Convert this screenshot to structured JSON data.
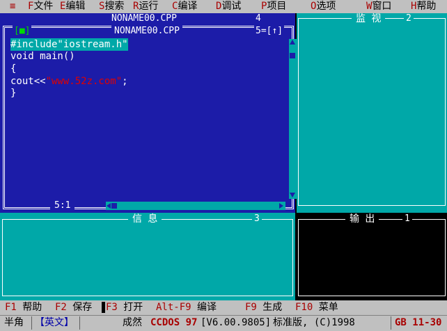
{
  "menu": {
    "items": [
      {
        "hot": "≡",
        "rest": ""
      },
      {
        "hot": "F",
        "rest": "文件"
      },
      {
        "hot": "E",
        "rest": "编辑"
      },
      {
        "hot": "S",
        "rest": "搜索"
      },
      {
        "hot": "R",
        "rest": "运行"
      },
      {
        "hot": "C",
        "rest": "编译"
      },
      {
        "hot": "D",
        "rest": "调试"
      },
      {
        "hot": "P",
        "rest": "项目"
      },
      {
        "hot": "O",
        "rest": "选项"
      },
      {
        "hot": "W",
        "rest": "窗口"
      },
      {
        "hot": "H",
        "rest": "帮助"
      }
    ]
  },
  "back_window": {
    "title": "NONAME00.CPP",
    "number": "4"
  },
  "editor": {
    "title": "NONAME00.CPP",
    "close_box": "[■]",
    "window_number": "5=[↑]",
    "cursor_position": "5:1",
    "lines": [
      {
        "pre": "#include\"iostream.h\"",
        "str": "",
        "post": ""
      },
      {
        "pre": "void main()",
        "str": "",
        "post": ""
      },
      {
        "pre": "{",
        "str": "",
        "post": ""
      },
      {
        "pre": "cout<<",
        "str": "\"www.52z.com\"",
        "post": ";"
      },
      {
        "pre": "}",
        "str": "",
        "post": ""
      }
    ]
  },
  "watch_window": {
    "title": "监 视",
    "number": "2"
  },
  "message_window": {
    "title": "信 息",
    "number": "3"
  },
  "output_window": {
    "title": "输  出",
    "number": "1"
  },
  "function_keys": [
    {
      "key": "F1",
      "label": "帮助"
    },
    {
      "key": "F2",
      "label": "保存"
    },
    {
      "key": "F3",
      "label": "打开"
    },
    {
      "key": "Alt-F9",
      "label": "编译"
    },
    {
      "key": "F9",
      "label": "生成"
    },
    {
      "key": "F10",
      "label": "菜单"
    }
  ],
  "status_bar": {
    "width_mode": "半角",
    "input_mode": "【英文】",
    "message": "成然",
    "product": "CCDOS 97",
    "version": "[V6.00.9805]",
    "edition": "标准版, (C)1998",
    "encoding": "GB 11-30"
  },
  "colors": {
    "editor_bg": "#1c1ca8",
    "panel_cyan": "#00a8a8",
    "menu_gray": "#c0c0c0",
    "hotkey_red": "#a80000",
    "string_red": "#e00000"
  }
}
